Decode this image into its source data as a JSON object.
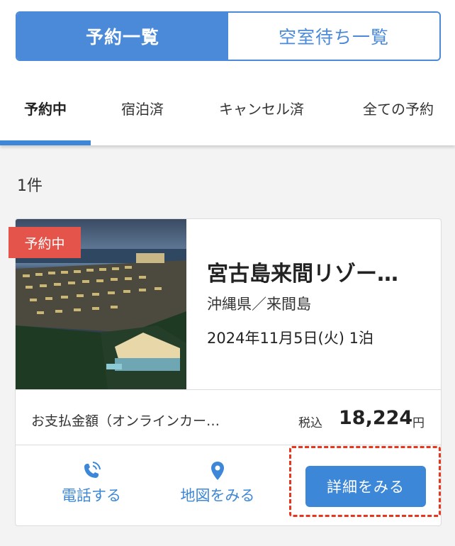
{
  "segment": {
    "active_label": "予約一覧",
    "inactive_label": "空室待ち一覧"
  },
  "tabs": [
    {
      "label": "予約中",
      "active": true
    },
    {
      "label": "宿泊済",
      "active": false
    },
    {
      "label": "キャンセル済",
      "active": false
    },
    {
      "label": "全ての予約",
      "active": false
    }
  ],
  "result_count": "1件",
  "reservation": {
    "status_badge": "予約中",
    "hotel_name": "宮古島来間リゾー…",
    "area": "沖縄県／来間島",
    "stay": "2024年11月5日(火)  1泊",
    "payment_label": "お支払金額（オンラインカー…",
    "tax_label": "税込",
    "price": "18,224",
    "currency": "円",
    "call_label": "電話する",
    "map_label": "地図をみる",
    "detail_label": "詳細をみる"
  },
  "colors": {
    "accent": "#3d87d8",
    "badge": "#e5544b",
    "highlight": "#e8361d"
  },
  "icons": {
    "call": "phone-ringing-icon",
    "map": "map-pin-icon"
  }
}
